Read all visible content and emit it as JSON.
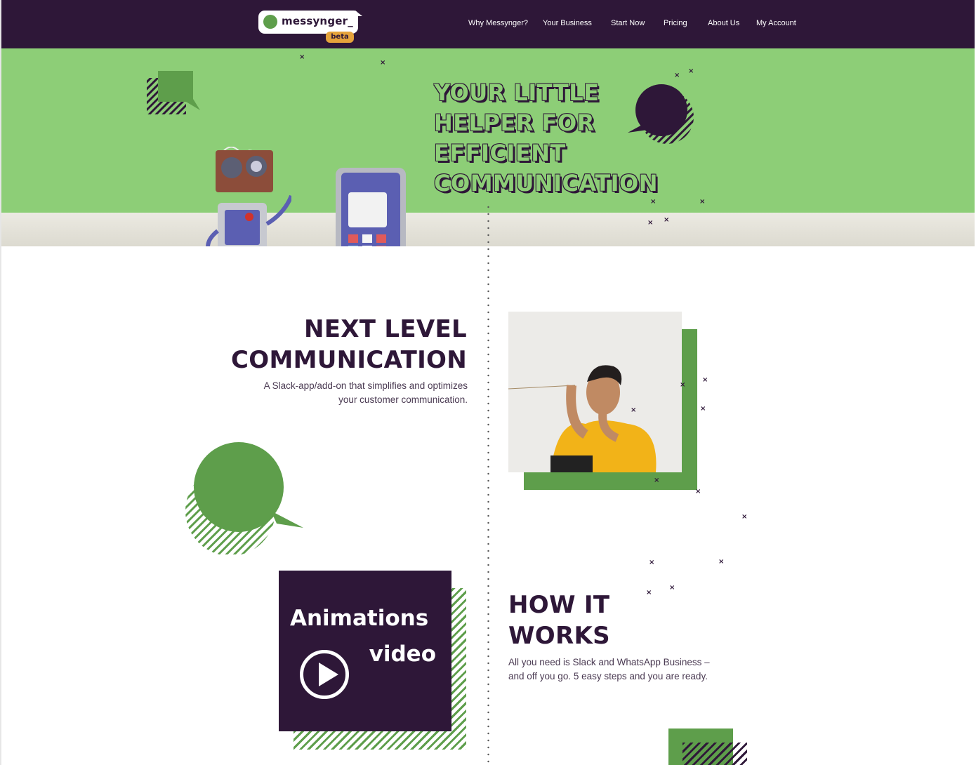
{
  "brand": {
    "name": "messynger_",
    "badge": "beta"
  },
  "nav": {
    "links": [
      {
        "label": "Why Messynger?"
      },
      {
        "label": "Your Business"
      },
      {
        "label": "Start Now"
      },
      {
        "label": "Pricing"
      },
      {
        "label": "About Us"
      },
      {
        "label": "My Account"
      }
    ]
  },
  "hero": {
    "title_line1": "YOUR LITTLE",
    "title_line2": "HELPER FOR",
    "title_line3": "EFFICIENT",
    "title_line4": "COMMUNICATION"
  },
  "next_level": {
    "heading_line1": "NEXT LEVEL",
    "heading_line2": "COMMUNICATION",
    "text_line1": "A Slack-app/add-on that simplifies and optimizes",
    "text_line2": "your customer communication."
  },
  "video": {
    "line1": "Animations",
    "line2": "video",
    "icon": "play-icon"
  },
  "how_it_works": {
    "heading_line1": "HOW IT",
    "heading_line2": "WORKS",
    "text_line1": "All you need is Slack and WhatsApp Business –",
    "text_line2": "and off you go. 5 easy steps and you are ready."
  },
  "colors": {
    "brand_dark": "#2e1738",
    "hero_green": "#8dce77",
    "accent_green": "#5e9e4b",
    "badge_orange": "#e5a33b"
  }
}
